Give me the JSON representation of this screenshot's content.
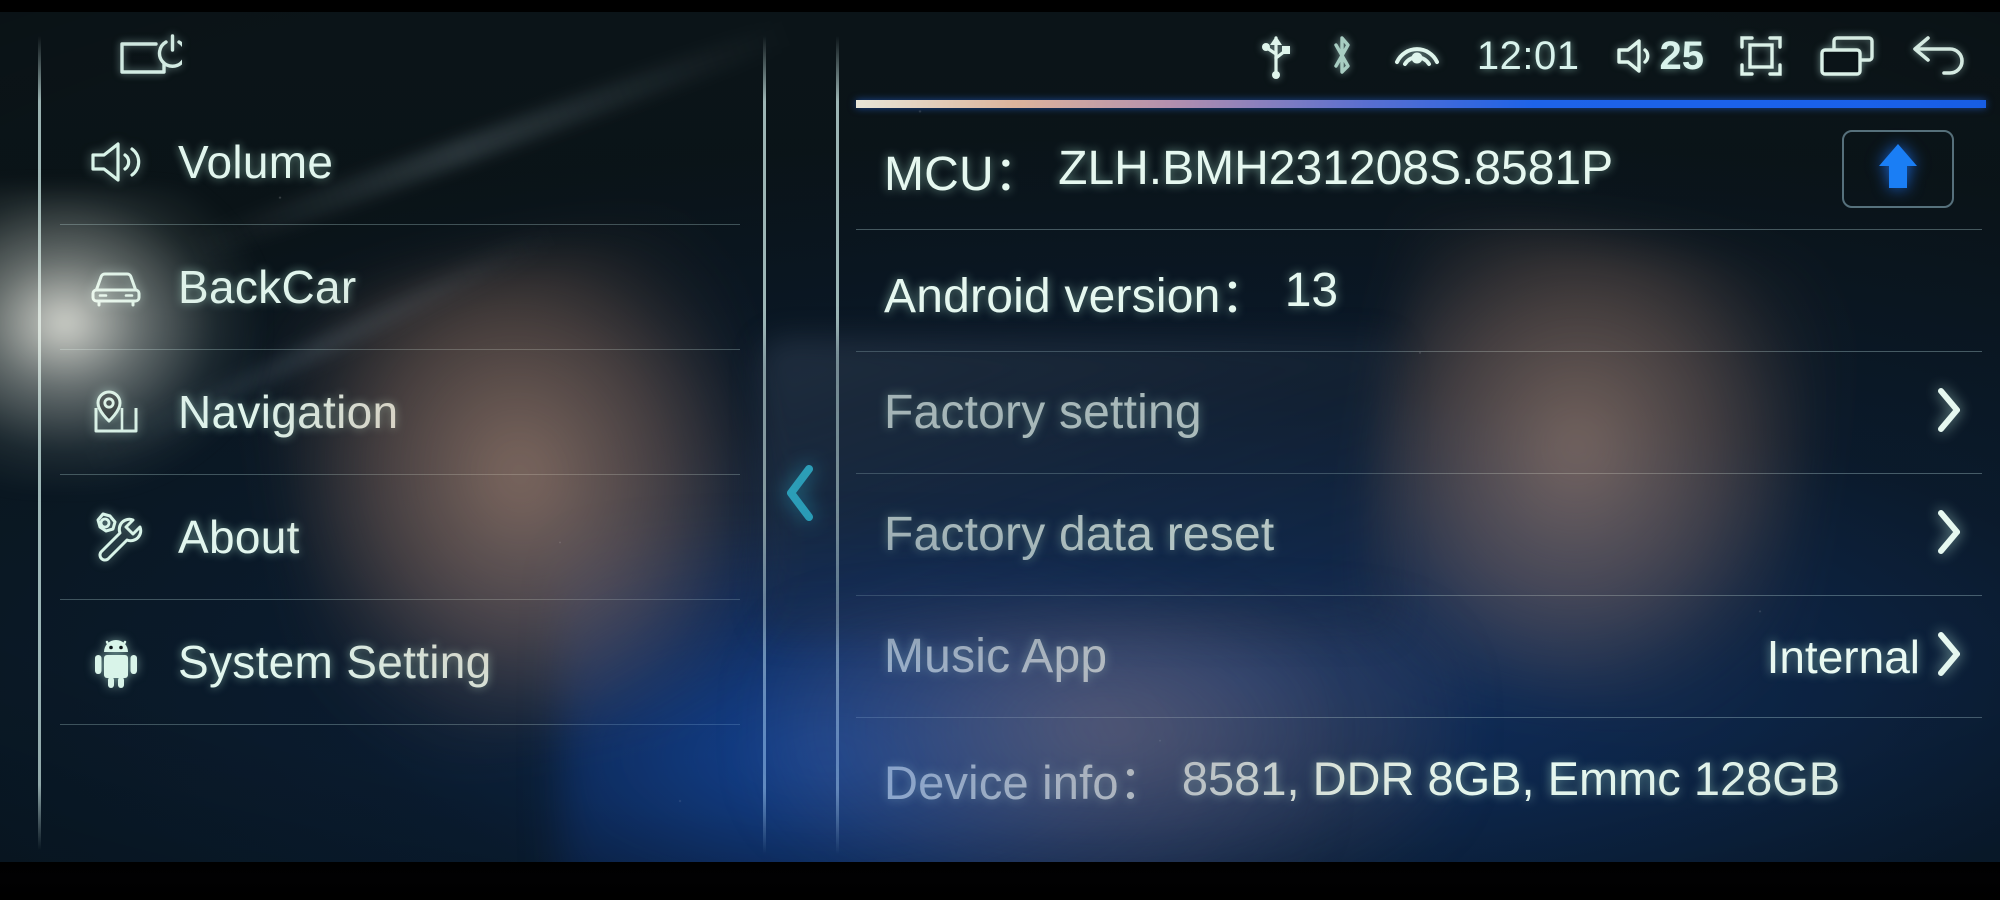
{
  "statusbar": {
    "screen_off_icon": "screen-power-off-icon",
    "usb_icon": "usb-icon",
    "bluetooth_icon": "bluetooth-icon",
    "hotspot_icon": "wifi-hotspot-icon",
    "time": "12:01",
    "volume_icon": "volume-icon",
    "volume_level": "25",
    "fullscreen_icon": "fullscreen-icon",
    "recents_icon": "recent-apps-icon",
    "back_icon": "back-arrow-icon"
  },
  "sidebar": {
    "items": [
      {
        "label": "Volume",
        "icon": "volume-icon"
      },
      {
        "label": "BackCar",
        "icon": "car-front-icon"
      },
      {
        "label": "Navigation",
        "icon": "map-pin-icon"
      },
      {
        "label": "About",
        "icon": "wrench-gear-icon"
      },
      {
        "label": "System Setting",
        "icon": "android-robot-icon"
      }
    ],
    "collapse_icon": "chevron-left-icon"
  },
  "content": {
    "rows": [
      {
        "label": "MCU：",
        "value": "ZLH.BMH231208S.8581P",
        "action": "update-button",
        "action_icon": "arrow-up-icon"
      },
      {
        "label": "Android version：",
        "value": "13"
      },
      {
        "label": "Factory setting",
        "value": "",
        "chevron": "chevron-right-icon"
      },
      {
        "label": "Factory data reset",
        "value": "",
        "chevron": "chevron-right-icon"
      },
      {
        "label": "Music App",
        "value": "",
        "right_value": "Internal",
        "chevron": "chevron-right-icon"
      },
      {
        "label": "Device info：",
        "value": "8581, DDR 8GB, Emmc 128GB"
      }
    ]
  },
  "colors": {
    "accent_blue": "#1860ea",
    "text_teal": "#e6f8f0",
    "collapse_cyan": "#2ad2ef",
    "arrow_blue": "#1a7ef5"
  }
}
